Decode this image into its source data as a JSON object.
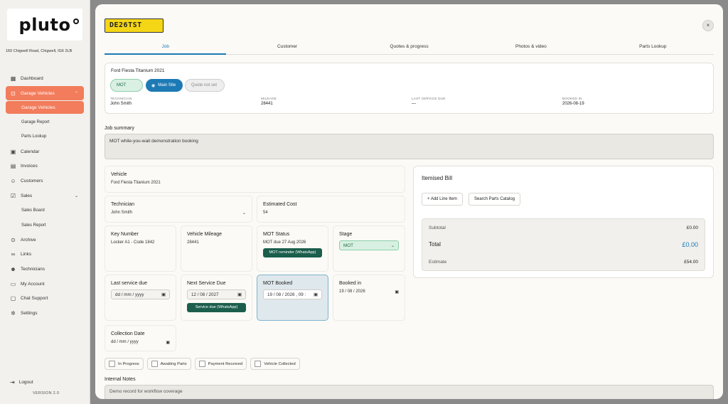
{
  "sidebar": {
    "logo": "pluto",
    "address": "160 Chigwell Road, Chigwell, IG6 2LB",
    "items": [
      {
        "label": "Dashboard",
        "icon": "grid-icon"
      },
      {
        "label": "Garage Vehicles",
        "icon": "car-icon"
      },
      {
        "label": "Garage Vehicles"
      },
      {
        "label": "Garage Report"
      },
      {
        "label": "Parts Lookup"
      },
      {
        "label": "Calendar",
        "icon": "calendar-icon"
      },
      {
        "label": "Invoices",
        "icon": "document-icon"
      },
      {
        "label": "Customers",
        "icon": "user-icon"
      },
      {
        "label": "Sales",
        "icon": "checklist-icon"
      },
      {
        "label": "Sales Board"
      },
      {
        "label": "Sales Report"
      },
      {
        "label": "Archive",
        "icon": "pin-icon"
      },
      {
        "label": "Links",
        "icon": "link-icon"
      },
      {
        "label": "Technicians",
        "icon": "users-icon"
      },
      {
        "label": "My Account",
        "icon": "card-icon"
      },
      {
        "label": "Chat Support",
        "icon": "chat-icon"
      },
      {
        "label": "Settings",
        "icon": "gear-icon"
      }
    ],
    "logout": "Logout",
    "version": "VERSION 2.0"
  },
  "modal": {
    "plate": "DE26TST",
    "close": "×",
    "tabs": [
      "Job",
      "Customer",
      "Quotes & progress",
      "Photos & video",
      "Parts Lookup"
    ],
    "vehicle_card": {
      "title": "Ford Fiesta Titanium 2021",
      "chips": {
        "mot": "MOT",
        "site": "Main Site",
        "quote": "Quote not set"
      },
      "meta": [
        {
          "label": "TECHNICIAN",
          "value": "John Smith"
        },
        {
          "label": "MILEAGE",
          "value": "28441"
        },
        {
          "label": "LAST SERVICE DUE",
          "value": "—"
        },
        {
          "label": "BOOKED IN",
          "value": "2026-08-19"
        }
      ]
    },
    "job_summary_label": "Job summary",
    "job_summary": "MOT while-you-wait demonstration booking",
    "fields": {
      "vehicle": {
        "title": "Vehicle",
        "value": "Ford Fiesta Titanium 2021"
      },
      "technician": {
        "title": "Technician",
        "value": "John Smith"
      },
      "estimated_cost": {
        "title": "Estimated Cost",
        "value": "54"
      },
      "key_number": {
        "title": "Key Number",
        "value": "Locker A1 - Code 1842"
      },
      "vehicle_mileage": {
        "title": "Vehicle Mileage",
        "value": "28441"
      },
      "mot_status": {
        "title": "MOT Status",
        "value": "MOT due 27 Aug 2026",
        "button": "MOT reminder (WhatsApp)"
      },
      "stage": {
        "title": "Stage",
        "value": "MOT"
      },
      "last_service_due": {
        "title": "Last service due",
        "value": "dd / mm / yyyy"
      },
      "next_service_due": {
        "title": "Next Service Due",
        "value": "12 / 08 / 2027",
        "button": "Service due (WhatsApp)"
      },
      "mot_booked": {
        "title": "MOT Booked",
        "value": "19 / 08 / 2026 , 09 :"
      },
      "booked_in": {
        "title": "Booked in",
        "value": "19 / 08 / 2026"
      },
      "collection_date": {
        "title": "Collection Date",
        "value": "dd / mm / yyyy"
      }
    },
    "bill": {
      "title": "Itemised Bill",
      "add_line": "+ Add Line Item",
      "search_catalog": "Search Parts Catalog",
      "subtotal_label": "Subtotal",
      "subtotal": "£0.00",
      "total_label": "Total",
      "total": "£0.00",
      "estimate_label": "Estimate",
      "estimate": "£54.00"
    },
    "checks": [
      "In Progress",
      "Awaiting Parts",
      "Payment Received",
      "Vehicle Collected"
    ],
    "internal_notes_label": "Internal Notes",
    "internal_notes": "Demo record for workflow coverage"
  }
}
